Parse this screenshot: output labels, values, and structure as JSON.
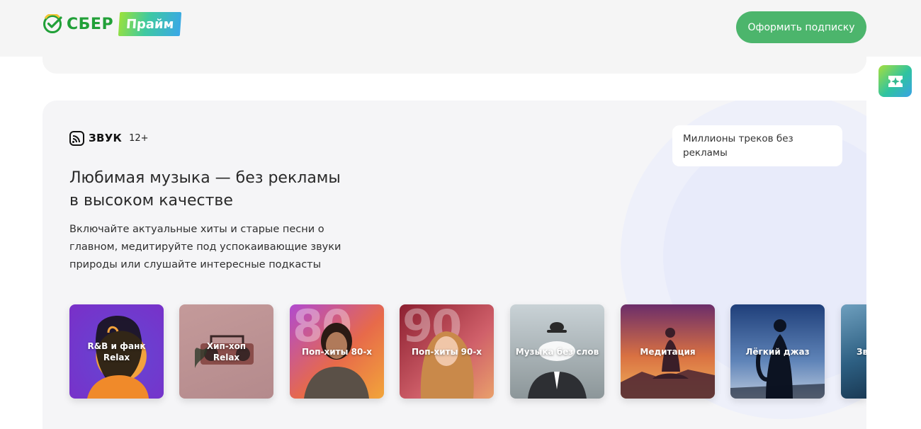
{
  "header": {
    "logo_text": "СБЕР",
    "prime_badge": "Прайм",
    "cta_label": "Оформить подписку"
  },
  "service": {
    "brand_name": "ЗВУК",
    "age_rating": "12+",
    "title_line1": "Любимая музыка — без рекламы",
    "title_line2": "в высоком качестве",
    "description": "Включайте актуальные хиты и старые песни о главном, медитируйте под успокаивающие звуки природы или слушайте интересные подкасты",
    "feature_chip": "Миллионы треков без рекламы"
  },
  "playlists": [
    {
      "label_line1": "R&B и фанк",
      "label_line2": "Relax"
    },
    {
      "label_line1": "Хип-хоп",
      "label_line2": "Relax"
    },
    {
      "label_line1": "Поп-хиты 80-х",
      "label_line2": "",
      "number": "80"
    },
    {
      "label_line1": "Поп-хиты 90-х",
      "label_line2": "",
      "number": "90"
    },
    {
      "label_line1": "Музыка без слов",
      "label_line2": ""
    },
    {
      "label_line1": "Медитация",
      "label_line2": ""
    },
    {
      "label_line1": "Лёгкий джаз",
      "label_line2": ""
    },
    {
      "label_line1": "Зв",
      "label_line2": ""
    }
  ],
  "colors": {
    "brand_green": "#21a038",
    "cta_green": "#4cb56c",
    "card_bg": "#f5f5f7"
  },
  "icons": {
    "logo": "sber-check-icon",
    "side_widget": "sparkle-ticket-icon",
    "brand": "zvuk-logo-icon"
  }
}
